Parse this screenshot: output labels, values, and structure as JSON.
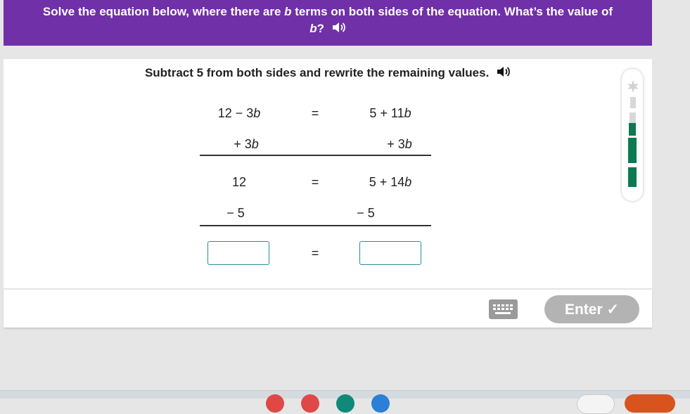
{
  "question": {
    "before": "Solve the equation below, where there are ",
    "var1": "b",
    "after": " terms on both sides of the equation. What’s the value of",
    "var2": "b",
    "end": "?"
  },
  "instruction": "Subtract 5 from both sides and rewrite the remaining values.",
  "rows": [
    {
      "left_pre": "12 − 3",
      "left_var": "b",
      "right_pre": "5 + 11",
      "right_var": "b",
      "eq": "="
    },
    {
      "left_pre": "+ 3",
      "left_var": "b",
      "right_pre": "+ 3",
      "right_var": "b"
    },
    {
      "left": "12",
      "right_pre": "5 + 14",
      "right_var": "b",
      "eq": "="
    },
    {
      "left": "− 5",
      "right": "− 5"
    },
    {
      "eq": "="
    }
  ],
  "answer": {
    "left_value": "",
    "right_value": ""
  },
  "footer": {
    "enter_label": "Enter ✓",
    "keyboard_icon": "keyboard-icon"
  },
  "progress": {
    "completed_steps": 3,
    "total_steps": 5,
    "color_done": "#0b7a52",
    "color_todo": "#c8c8c8"
  },
  "colors": {
    "header": "#7030a8",
    "input_border": "#2a8aa0",
    "enter_disabled": "#b3b3b3"
  }
}
